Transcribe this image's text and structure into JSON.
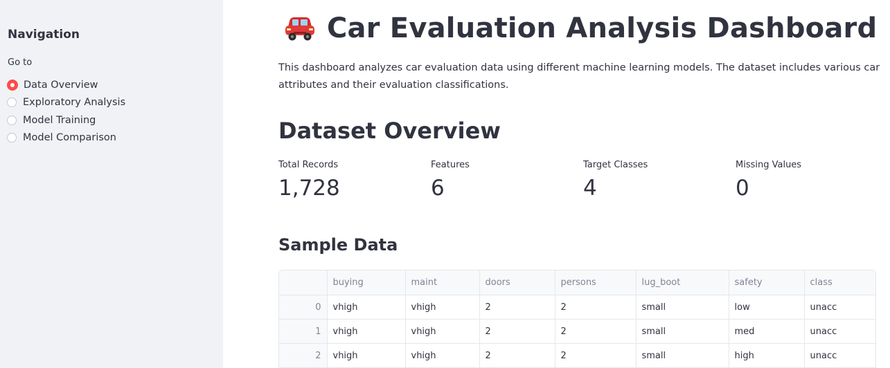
{
  "sidebar": {
    "title": "Navigation",
    "radio_label": "Go to",
    "options": [
      "Data Overview",
      "Exploratory Analysis",
      "Model Training",
      "Model Comparison"
    ],
    "selected": "Data Overview",
    "accent_color": "#ff4b4b"
  },
  "header": {
    "icon": "car-icon",
    "title": "Car Evaluation Analysis Dashboard"
  },
  "intro": "This dashboard analyzes car evaluation data using different machine learning models. The dataset includes various car attributes and their evaluation classifications.",
  "overview": {
    "title": "Dataset Overview",
    "metrics": [
      {
        "label": "Total Records",
        "value": "1,728"
      },
      {
        "label": "Features",
        "value": "6"
      },
      {
        "label": "Target Classes",
        "value": "4"
      },
      {
        "label": "Missing Values",
        "value": "0"
      }
    ]
  },
  "sample": {
    "title": "Sample Data",
    "columns": [
      "",
      "buying",
      "maint",
      "doors",
      "persons",
      "lug_boot",
      "safety",
      "class"
    ],
    "rows": [
      [
        "0",
        "vhigh",
        "vhigh",
        "2",
        "2",
        "small",
        "low",
        "unacc"
      ],
      [
        "1",
        "vhigh",
        "vhigh",
        "2",
        "2",
        "small",
        "med",
        "unacc"
      ],
      [
        "2",
        "vhigh",
        "vhigh",
        "2",
        "2",
        "small",
        "high",
        "unacc"
      ]
    ]
  }
}
